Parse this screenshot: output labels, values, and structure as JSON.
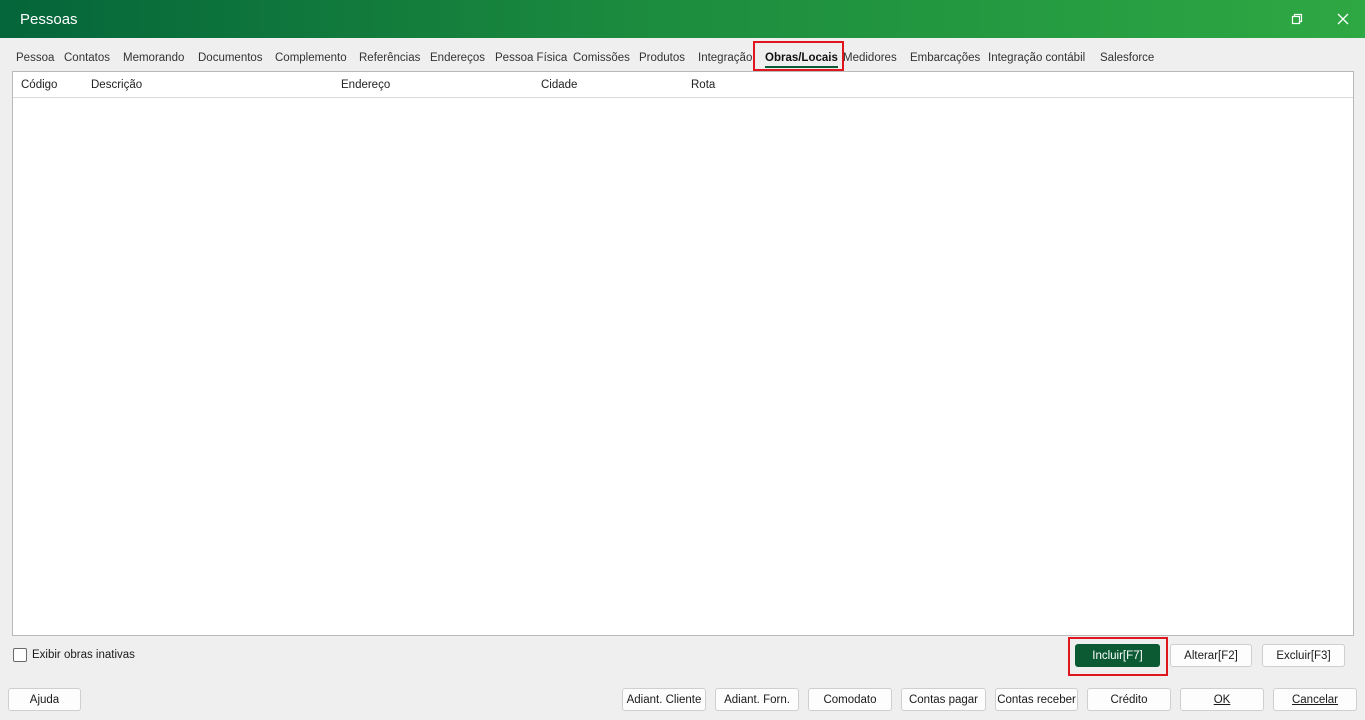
{
  "window": {
    "title": "Pessoas"
  },
  "tabs": [
    {
      "label": "Pessoa"
    },
    {
      "label": "Contatos"
    },
    {
      "label": "Memorando"
    },
    {
      "label": "Documentos"
    },
    {
      "label": "Complemento"
    },
    {
      "label": "Referências"
    },
    {
      "label": "Endereços"
    },
    {
      "label": "Pessoa Física"
    },
    {
      "label": "Comissões"
    },
    {
      "label": "Produtos"
    },
    {
      "label": "Integração"
    },
    {
      "label": "Obras/Locais",
      "active": true
    },
    {
      "label": "Medidores"
    },
    {
      "label": "Embarcações"
    },
    {
      "label": "Integração contábil"
    },
    {
      "label": "Salesforce"
    }
  ],
  "grid": {
    "columns": [
      "Código",
      "Descrição",
      "Endereço",
      "Cidade",
      "Rota"
    ],
    "rows": []
  },
  "options": {
    "show_inactive_label": "Exibir obras inativas",
    "show_inactive_checked": false
  },
  "actions": {
    "include": "Incluir[F7]",
    "edit": "Alterar[F2]",
    "delete": "Excluir[F3]"
  },
  "footer": {
    "help": "Ajuda",
    "client_advance": "Adiant. Cliente",
    "supplier_advance": "Adiant. Forn.",
    "loan": "Comodato",
    "payables": "Contas pagar",
    "receivables": "Contas receber",
    "credit": "Crédito",
    "ok": "OK",
    "cancel": "Cancelar"
  },
  "colors": {
    "title_gradient_start": "#04653a",
    "title_gradient_end": "#2ea843",
    "primary_button": "#0b5a34",
    "highlight": "#e0161f"
  }
}
